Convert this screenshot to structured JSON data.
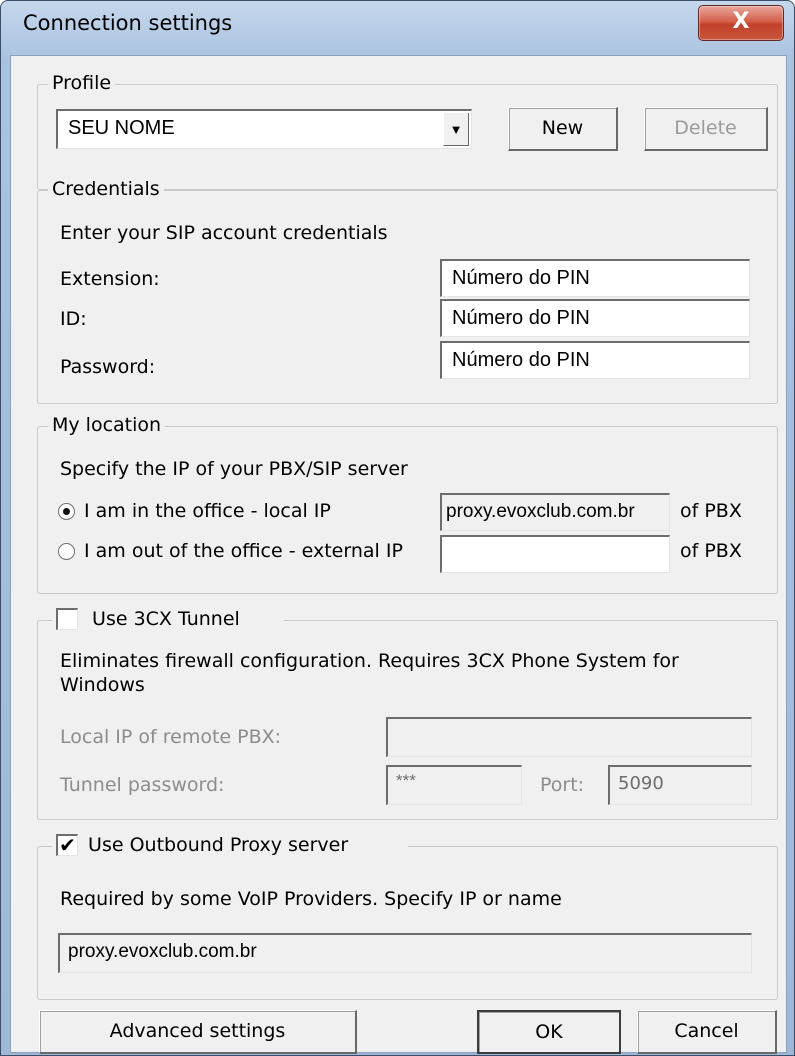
{
  "window": {
    "title": "Connection settings",
    "close_glyph": "X"
  },
  "profile": {
    "group_title": "Profile",
    "selected": "SEU NOME",
    "new_label": "New",
    "delete_label": "Delete"
  },
  "credentials": {
    "group_title": "Credentials",
    "intro": "Enter your SIP account credentials",
    "extension_label": "Extension:",
    "extension_value": "Número do PIN",
    "id_label": "ID:",
    "id_value": "Número do PIN",
    "password_label": "Password:",
    "password_value": "Número do PIN"
  },
  "location": {
    "group_title": "My location",
    "intro": "Specify the IP of your PBX/SIP server",
    "local_label": "I am in the office - local IP",
    "local_value": "proxy.evoxclub.com.br",
    "local_suffix": "of PBX",
    "external_label": "I am out of the office - external IP",
    "external_value": "",
    "external_suffix": "of PBX",
    "selected": "local"
  },
  "tunnel": {
    "checkbox_label": "Use 3CX Tunnel",
    "checked": false,
    "description": "Eliminates firewall configuration. Requires 3CX Phone System for Windows",
    "description_line1": "Eliminates firewall configuration. Requires 3CX Phone System for",
    "description_line2": "Windows",
    "remote_ip_label": "Local IP of remote PBX:",
    "remote_ip_value": "",
    "password_label": "Tunnel password:",
    "password_value": "***",
    "port_label": "Port:",
    "port_value": "5090"
  },
  "proxy": {
    "checkbox_label": "Use Outbound Proxy server",
    "checked": true,
    "description": "Required by some VoIP Providers. Specify IP or name",
    "value": "proxy.evoxclub.com.br"
  },
  "footer": {
    "advanced_label": "Advanced settings",
    "ok_label": "OK",
    "cancel_label": "Cancel"
  },
  "icons": {
    "combo_arrow": "chevron-down-icon",
    "checkmark": "check-icon",
    "close": "close-icon"
  }
}
